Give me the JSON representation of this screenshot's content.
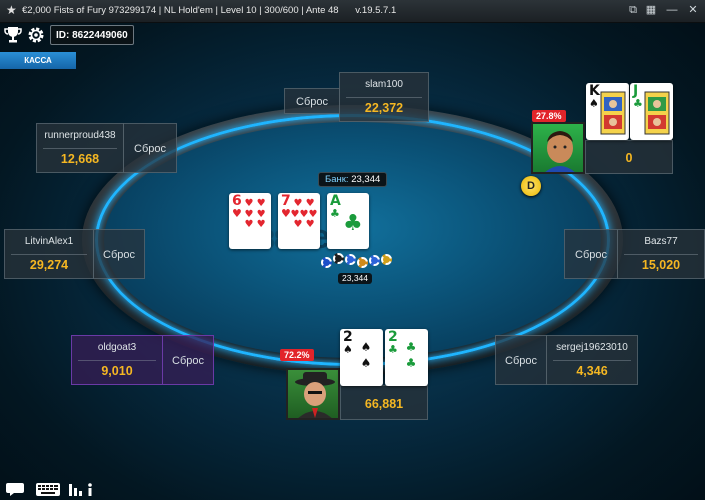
{
  "window": {
    "title": "€2,000 Fists of Fury 973299174 | NL Hold'em | Level 10 | 300/600 | Ante 48",
    "version": "v.19.5.7.1"
  },
  "topbar": {
    "id_label": "ID: 8622449060",
    "cashier_label": "КАССА"
  },
  "table": {
    "logo": "888",
    "logo_suffix": "Bet",
    "pot_label": "Банк:",
    "pot_value": "23,344",
    "chips_total": "23,344"
  },
  "board": [
    {
      "rank": "6",
      "suit": "♥",
      "color": "red"
    },
    {
      "rank": "7",
      "suit": "♥",
      "color": "red"
    },
    {
      "rank": "A",
      "suit": "♣",
      "color": "green"
    }
  ],
  "fold_label": "Сброс",
  "seats": {
    "slam100": {
      "name": "slam100",
      "stack": "22,372"
    },
    "runnerproud438": {
      "name": "runnerproud438",
      "stack": "12,668"
    },
    "litvinalex1": {
      "name": "LitvinAlex1",
      "stack": "29,274"
    },
    "oldgoat3": {
      "name": "oldgoat3",
      "stack": "9,010"
    },
    "hero": {
      "stack": "66,881",
      "equity": "72.2%"
    },
    "sergej": {
      "name": "sergej19623010",
      "stack": "4,346"
    },
    "bazs77": {
      "name": "Bazs77",
      "stack": "15,020"
    },
    "kj_player": {
      "stack": "0",
      "equity": "27.8%"
    }
  },
  "hero_cards": [
    {
      "rank": "2",
      "suit": "♠",
      "color": "black"
    },
    {
      "rank": "2",
      "suit": "♣",
      "color": "green"
    }
  ],
  "villain_cards": [
    {
      "rank": "K",
      "suit": "♠",
      "color": "black"
    },
    {
      "rank": "J",
      "suit": "♣",
      "color": "green"
    }
  ],
  "dealer_button": "D",
  "colors": {
    "accent": "#1fb5ff",
    "stack": "#f5b722",
    "equity": "#e2242a"
  }
}
